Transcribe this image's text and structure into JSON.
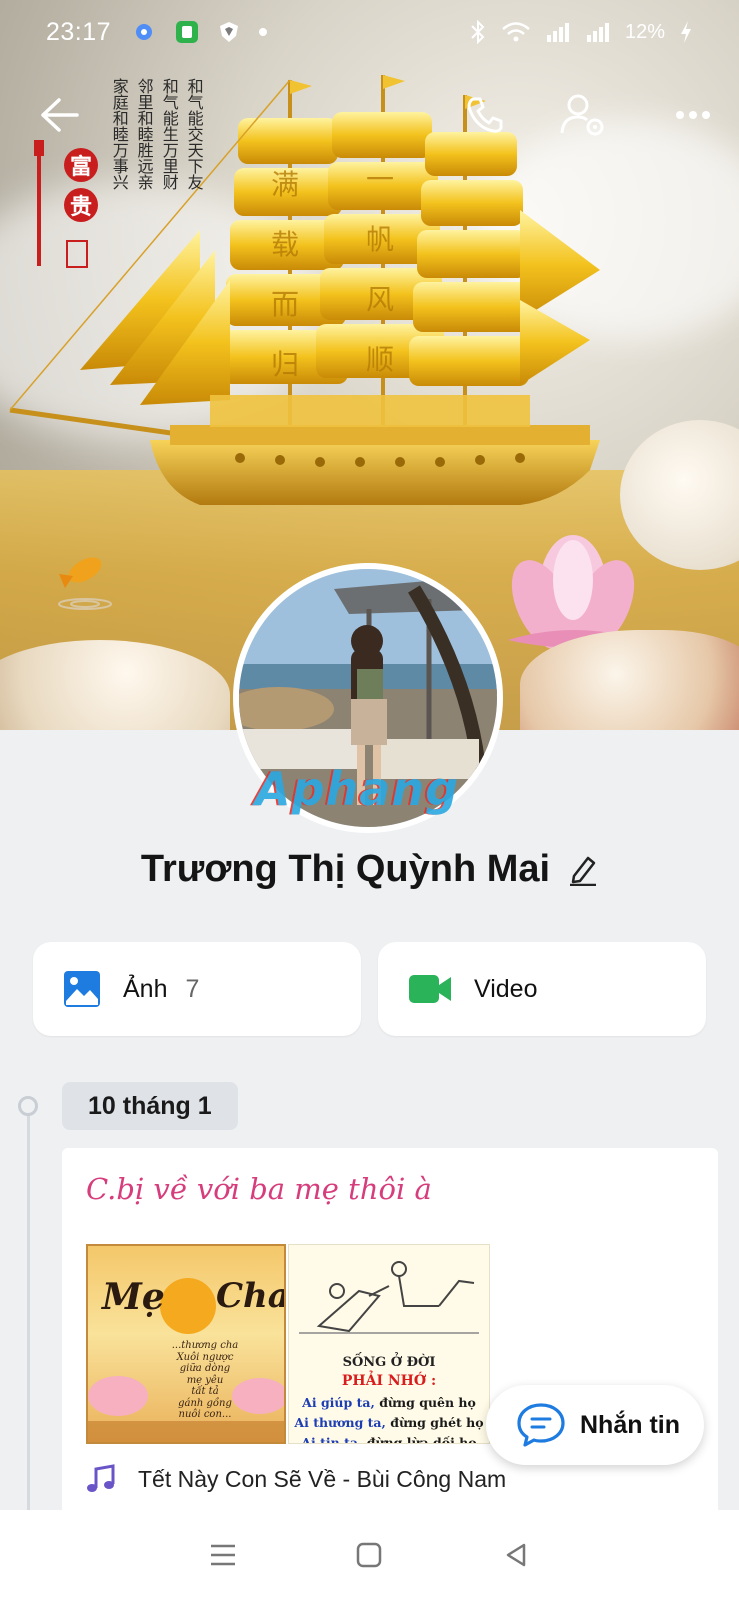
{
  "status_bar": {
    "time": "23:17",
    "battery": "12%",
    "icons": [
      "gear-icon",
      "app-icon",
      "shield-icon",
      "dot-icon",
      "bluetooth-icon",
      "wifi-icon",
      "signal-icon",
      "signal-icon",
      "charging-icon"
    ]
  },
  "header": {
    "actions": [
      "back-icon",
      "phone-icon",
      "profile-settings-icon",
      "more-icon"
    ]
  },
  "cover": {
    "calligraphy_right": [
      "和气能交天下友",
      "和气能生万里财"
    ],
    "calligraphy_left": [
      "邻里和睦胜远亲",
      "家庭和睦万事兴"
    ],
    "seal_top": "富",
    "seal_bottom": "贵",
    "sail_chars": [
      "满",
      "载",
      "而",
      "归",
      "一",
      "帆",
      "风",
      "顺"
    ]
  },
  "profile": {
    "name": "Trương Thị Quỳnh Mai",
    "watermark": "Aphang"
  },
  "media": {
    "photos_label": "Ảnh",
    "photos_count": "7",
    "video_label": "Video"
  },
  "timeline": {
    "date": "10 tháng 1",
    "post": {
      "text": "C.bị về với ba mẹ thôi à",
      "image1": {
        "big_left": "Mẹ",
        "big_right": "Cha",
        "lines": [
          "...thương cha",
          "Xuôi ngược",
          "giữa dòng",
          "mẹ yêu",
          "tất tả",
          "gánh gồng",
          "nuôi con..."
        ]
      },
      "image2": {
        "title": "SỐNG Ở ĐỜI",
        "subtitle": "PHẢI NHỚ :",
        "lines": [
          {
            "blue": "Ai giúp ta,",
            "black": " đừng quên họ"
          },
          {
            "blue": "Ai thương ta,",
            "black": " đừng ghét họ"
          },
          {
            "blue": "Ai tin ta,",
            "black": " đừng lừa dối họ"
          }
        ]
      },
      "song": "Tết Này Con Sẽ Về - Bùi Công Nam"
    }
  },
  "floating": {
    "message_label": "Nhắn tin"
  },
  "navbar": [
    "menu-icon",
    "home-icon",
    "back-triangle-icon"
  ],
  "colors": {
    "post_text": "#d63d7c",
    "photo_icon": "#1e7be0",
    "video_icon": "#2bb35a",
    "message_icon": "#1e7be0"
  }
}
